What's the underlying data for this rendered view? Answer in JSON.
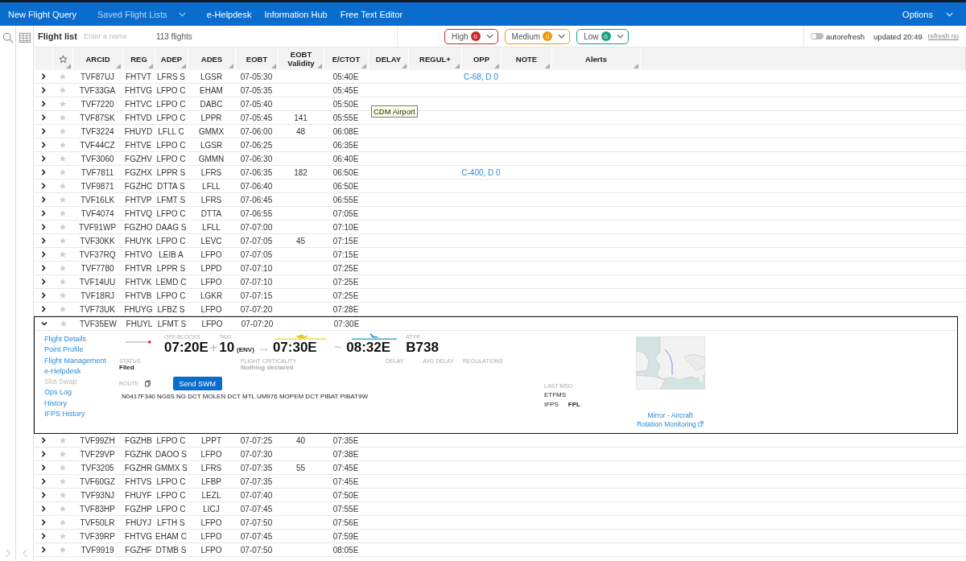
{
  "nav": {
    "items": [
      {
        "label": "New Flight Query",
        "disabled": false,
        "dropdown": false
      },
      {
        "label": "Saved Flight Lists",
        "disabled": true,
        "dropdown": true
      },
      {
        "label": "e-Helpdesk",
        "disabled": false,
        "dropdown": false
      },
      {
        "label": "Information Hub",
        "disabled": false,
        "dropdown": false
      },
      {
        "label": "Free Text Editor",
        "disabled": false,
        "dropdown": false
      }
    ],
    "options": "Options"
  },
  "toolbar": {
    "title": "Flight list",
    "name_placeholder": "Enter a name",
    "count": "113 flights",
    "filters": [
      {
        "label": "High",
        "count": "0",
        "color": "#c62828"
      },
      {
        "label": "Medium",
        "count": "0",
        "color": "#f0960a"
      },
      {
        "label": "Low",
        "count": "0",
        "color": "#17a085"
      }
    ],
    "autorefresh": {
      "label": "autorefresh",
      "on": false
    },
    "updated": "updated 20:49",
    "refresh": "refresh no"
  },
  "table": {
    "columns": [
      {
        "label": "ARCID"
      },
      {
        "label": "REG"
      },
      {
        "label": "ADEP"
      },
      {
        "label": "ADES"
      },
      {
        "label": "EOBT"
      },
      {
        "label": "EOBT Validity"
      },
      {
        "label": "E/CTOT"
      },
      {
        "label": "DELAY"
      },
      {
        "label": "REGUL+"
      },
      {
        "label": "OPP"
      },
      {
        "label": "NOTE"
      },
      {
        "label": "Alerts"
      }
    ],
    "rows": [
      {
        "arcid": "TVF87UJ",
        "reg": "FHTVT",
        "adep": "LFRS S",
        "ades": "LGSR",
        "eobt": "07-05:30",
        "ctot": "05:40E",
        "opp": "C-68, D 0",
        "starred": false,
        "expanded": false
      },
      {
        "arcid": "TVF33GA",
        "reg": "FHTVG",
        "adep": "LFPO C",
        "ades": "EHAM",
        "eobt": "07-05:35",
        "ctot": "05:45E",
        "starred": false,
        "expanded": false
      },
      {
        "arcid": "TVF7220",
        "reg": "FHTVC",
        "adep": "LFPO C",
        "ades": "DABC",
        "eobt": "07-05:40",
        "ctot": "05:50E",
        "tooltip": "CDM Airport",
        "starred": false,
        "expanded": false
      },
      {
        "arcid": "TVF87SK",
        "reg": "FHTVD",
        "adep": "LFPO C",
        "ades": "LPPR",
        "eobt": "07-05:45",
        "validity": "141",
        "ctot": "05:55E",
        "starred": false,
        "expanded": false
      },
      {
        "arcid": "TVF3224",
        "reg": "FHUYD",
        "adep": "LFLL C",
        "ades": "GMMX",
        "eobt": "07-06:00",
        "validity": "48",
        "ctot": "06:08E",
        "starred": false,
        "expanded": false
      },
      {
        "arcid": "TVF44CZ",
        "reg": "FHTVE",
        "adep": "LFPO C",
        "ades": "LGSR",
        "eobt": "07-06:25",
        "ctot": "06:35E",
        "starred": false,
        "expanded": false
      },
      {
        "arcid": "TVF3060",
        "reg": "FGZHV",
        "adep": "LFPO C",
        "ades": "GMMN",
        "eobt": "07-06:30",
        "ctot": "06:40E",
        "starred": false,
        "expanded": false
      },
      {
        "arcid": "TVF7811",
        "reg": "FGZHX",
        "adep": "LPPR S",
        "ades": "LFRS",
        "eobt": "07-06:35",
        "validity": "182",
        "ctot": "06:50E",
        "opp": "C-400, D 0",
        "starred": false,
        "expanded": false
      },
      {
        "arcid": "TVF9871",
        "reg": "FGZHC",
        "adep": "DTTA S",
        "ades": "LFLL",
        "eobt": "07-06:40",
        "ctot": "06:50E",
        "starred": false,
        "expanded": false
      },
      {
        "arcid": "TVF16LK",
        "reg": "FHTVP",
        "adep": "LFMT S",
        "ades": "LFRS",
        "eobt": "07-06:45",
        "ctot": "06:55E",
        "starred": false,
        "expanded": false
      },
      {
        "arcid": "TVF4074",
        "reg": "FHTVQ",
        "adep": "LFPO C",
        "ades": "DTTA",
        "eobt": "07-06:55",
        "ctot": "07:05E",
        "starred": false,
        "expanded": false
      },
      {
        "arcid": "TVF91WP",
        "reg": "FGZHO",
        "adep": "DAAG S",
        "ades": "LFLL",
        "eobt": "07-07:00",
        "ctot": "07:10E",
        "starred": false,
        "expanded": false
      },
      {
        "arcid": "TVF30KK",
        "reg": "FHUYK",
        "adep": "LFPO C",
        "ades": "LEVC",
        "eobt": "07-07:05",
        "validity": "45",
        "ctot": "07:15E",
        "starred": false,
        "expanded": false
      },
      {
        "arcid": "TVF37RQ",
        "reg": "FHTVO",
        "adep": "LEIB A",
        "ades": "LFPO",
        "eobt": "07-07:05",
        "ctot": "07:15E",
        "starred": false,
        "expanded": false
      },
      {
        "arcid": "TVF7780",
        "reg": "FHTVR",
        "adep": "LPPR S",
        "ades": "LPPD",
        "eobt": "07-07:10",
        "ctot": "07:25E",
        "starred": false,
        "expanded": false
      },
      {
        "arcid": "TVF14UU",
        "reg": "FHTVK",
        "adep": "LEMD C",
        "ades": "LFPO",
        "eobt": "07-07:10",
        "ctot": "07:25E",
        "starred": false,
        "expanded": false
      },
      {
        "arcid": "TVF18RJ",
        "reg": "FHTVB",
        "adep": "LFPO C",
        "ades": "LGKR",
        "eobt": "07-07:15",
        "ctot": "07:25E",
        "starred": false,
        "expanded": false
      },
      {
        "arcid": "TVF73UK",
        "reg": "FHUYG",
        "adep": "LFBZ S",
        "ades": "LFPO",
        "eobt": "07-07:20",
        "ctot": "07:28E",
        "starred": false,
        "expanded": false
      },
      {
        "arcid": "TVF35EW",
        "reg": "FHUYL",
        "adep": "LFMT S",
        "ades": "LFPO",
        "eobt": "07-07:20",
        "ctot": "07:30E",
        "starred": false,
        "expanded": true,
        "details": {
          "links": [
            {
              "label": "Flight Details",
              "disabled": false
            },
            {
              "label": "Point Profile",
              "disabled": false
            },
            {
              "label": "Flight Management",
              "disabled": false
            },
            {
              "label": "e-Helpdesk",
              "disabled": false
            },
            {
              "label": "Slot Swap",
              "disabled": true
            },
            {
              "label": "Ops Log",
              "disabled": false
            },
            {
              "label": "History",
              "disabled": false
            },
            {
              "label": "IFPS History",
              "disabled": false
            }
          ],
          "off_blocks": {
            "label": "OFF-BLOCKS",
            "value": "07:20E"
          },
          "plus": "+",
          "taxi": {
            "label": "TAXI",
            "value": "10",
            "unit": "(ENV)"
          },
          "arrow": "→",
          "departure": "07:30E",
          "tilde": "~",
          "arrival": "08:32E",
          "atyp": {
            "label": "ATYP",
            "value": "B738"
          },
          "status": {
            "label": "STATUS",
            "value": "Filed"
          },
          "criticality": {
            "label": "FLIGHT CRITICALITY",
            "value": "Nothing declared"
          },
          "delay_label": "DELAY",
          "avg_delay_label": "AVG DELAY",
          "regulations_label": "REGULATIONS",
          "route": {
            "label": "ROUTE",
            "text": "N0417F340 NG6S NG DCT MOLEN DCT MTL UM976 MOPEM DCT PIBAT PIBAT9W"
          },
          "send_button": "Send SWM",
          "last_msg": {
            "label": "LAST MSG",
            "rows": [
              {
                "source": "ETFMS"
              },
              {
                "source": "IFPS",
                "message": "FPL"
              }
            ]
          },
          "mirror_link": "Mirror - Aircraft Rotation Monitoring"
        }
      },
      {
        "arcid": "TVF99ZH",
        "reg": "FGZHB",
        "adep": "LFPO C",
        "ades": "LPPT",
        "eobt": "07-07:25",
        "validity": "40",
        "ctot": "07:35E",
        "starred": false,
        "expanded": false
      },
      {
        "arcid": "TVF29VP",
        "reg": "FGZHK",
        "adep": "DAOO S",
        "ades": "LFPO",
        "eobt": "07-07:30",
        "ctot": "07:38E",
        "starred": false,
        "expanded": false
      },
      {
        "arcid": "TVF3205",
        "reg": "FGZHR",
        "adep": "GMMX S",
        "ades": "LFRS",
        "eobt": "07-07:35",
        "validity": "55",
        "ctot": "07:45E",
        "starred": false,
        "expanded": false
      },
      {
        "arcid": "TVF60GZ",
        "reg": "FHTVS",
        "adep": "LFPO C",
        "ades": "LFBP",
        "eobt": "07-07:35",
        "ctot": "07:45E",
        "starred": false,
        "expanded": false
      },
      {
        "arcid": "TVF93NJ",
        "reg": "FHUYF",
        "adep": "LFPO C",
        "ades": "LEZL",
        "eobt": "07-07:40",
        "ctot": "07:50E",
        "starred": false,
        "expanded": false
      },
      {
        "arcid": "TVF83HP",
        "reg": "FGZHP",
        "adep": "LFPO C",
        "ades": "LICJ",
        "eobt": "07-07:45",
        "ctot": "07:55E",
        "starred": false,
        "expanded": false
      },
      {
        "arcid": "TVF50LR",
        "reg": "FHUYJ",
        "adep": "LFTH S",
        "ades": "LFPO",
        "eobt": "07-07:50",
        "ctot": "07:56E",
        "starred": false,
        "expanded": false
      },
      {
        "arcid": "TVF39RP",
        "reg": "FHTVG",
        "adep": "EHAM C",
        "ades": "LFPO",
        "eobt": "07-07:45",
        "ctot": "07:59E",
        "starred": false,
        "expanded": false
      },
      {
        "arcid": "TVF9919",
        "reg": "FGZHF",
        "adep": "DTMB S",
        "ades": "LFPO",
        "eobt": "07-07:50",
        "ctot": "08:05E",
        "starred": false,
        "expanded": false
      }
    ]
  }
}
